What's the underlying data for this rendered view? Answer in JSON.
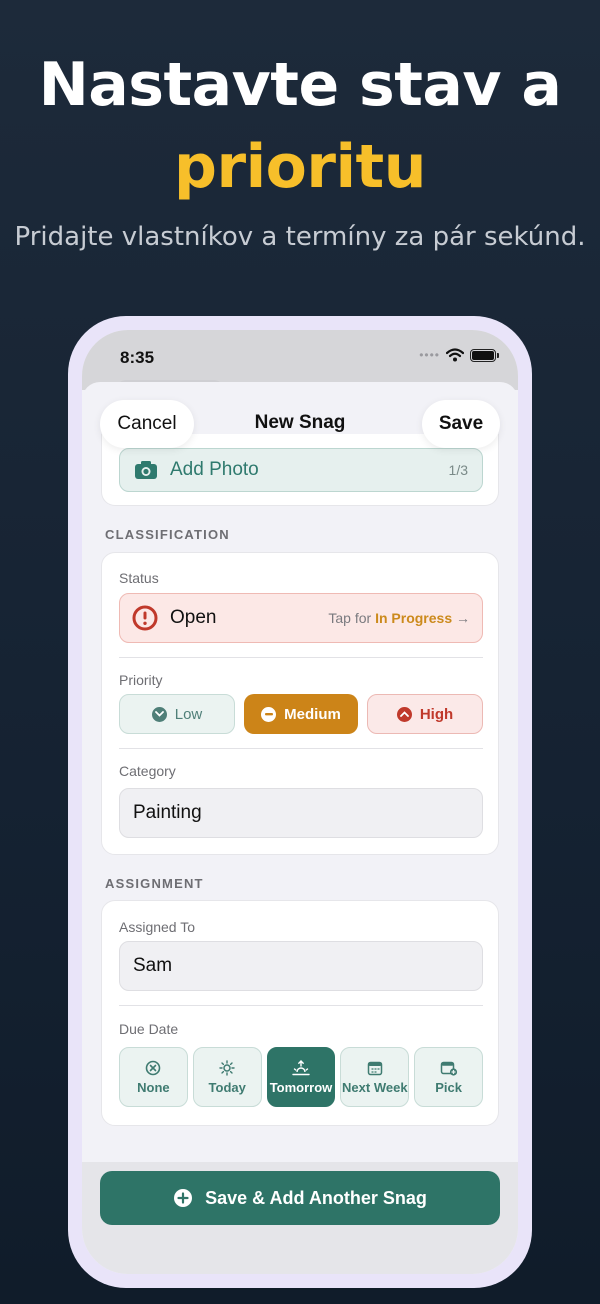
{
  "promo": {
    "headline_line1": "Nastavte stav a",
    "headline_line2": "prioritu",
    "subheadline": "Pridajte vlastníkov a termíny za pár sekúnd."
  },
  "status_bar": {
    "time": "8:35"
  },
  "nav": {
    "cancel_label": "Cancel",
    "title": "New Snag",
    "save_label": "Save"
  },
  "photo": {
    "label": "Add Photo",
    "count": "1/3"
  },
  "classification": {
    "section_title": "CLASSIFICATION",
    "status_label": "Status",
    "status_value": "Open",
    "status_hint_prefix": "Tap for",
    "status_hint_next": "In Progress",
    "status_hint_arrow": "→",
    "priority_label": "Priority",
    "priorities": [
      {
        "label": "Low",
        "icon": "chevron-down-circle-icon"
      },
      {
        "label": "Medium",
        "icon": "minus-circle-icon",
        "selected": true
      },
      {
        "label": "High",
        "icon": "chevron-up-circle-icon"
      }
    ],
    "category_label": "Category",
    "category_value": "Painting"
  },
  "assignment": {
    "section_title": "ASSIGNMENT",
    "assigned_label": "Assigned To",
    "assigned_value": "Sam",
    "due_label": "Due Date",
    "due_options": [
      {
        "label": "None",
        "icon": "x-circle-icon"
      },
      {
        "label": "Today",
        "icon": "sun-icon"
      },
      {
        "label": "Tomorrow",
        "icon": "sunrise-icon",
        "selected": true
      },
      {
        "label": "Next Week",
        "icon": "calendar-icon"
      },
      {
        "label": "Pick",
        "icon": "calendar-add-icon"
      }
    ]
  },
  "footer": {
    "primary_label": "Save & Add Another Snag"
  },
  "colors": {
    "accent_teal": "#2e7467",
    "medium_orange": "#cc8418",
    "high_red": "#c0392b",
    "headline_yellow": "#f7bf2a"
  }
}
